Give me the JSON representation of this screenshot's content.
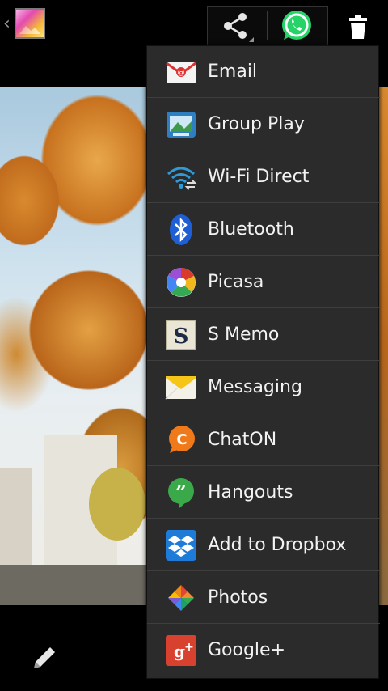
{
  "action_bar": {
    "back_icon": "chevron-left-icon",
    "app_icon": "gallery-icon",
    "share_icon": "share-icon",
    "whatsapp_icon": "whatsapp-icon",
    "delete_icon": "trash-icon"
  },
  "bottom_bar": {
    "edit_icon": "pencil-icon"
  },
  "share_menu": {
    "items": [
      {
        "label": "Email",
        "icon": "email-icon"
      },
      {
        "label": "Group Play",
        "icon": "group-play-icon"
      },
      {
        "label": "Wi-Fi Direct",
        "icon": "wifi-direct-icon"
      },
      {
        "label": "Bluetooth",
        "icon": "bluetooth-icon"
      },
      {
        "label": "Picasa",
        "icon": "picasa-icon"
      },
      {
        "label": "S Memo",
        "icon": "s-memo-icon"
      },
      {
        "label": "Messaging",
        "icon": "messaging-icon"
      },
      {
        "label": "ChatON",
        "icon": "chaton-icon"
      },
      {
        "label": "Hangouts",
        "icon": "hangouts-icon"
      },
      {
        "label": "Add to Dropbox",
        "icon": "dropbox-icon"
      },
      {
        "label": "Photos",
        "icon": "photos-icon"
      },
      {
        "label": "Google+",
        "icon": "google-plus-icon"
      }
    ]
  },
  "colors": {
    "menu_bg": "#2b2b2b",
    "whatsapp_green": "#25d366",
    "bluetooth_blue": "#1f5fd6"
  }
}
